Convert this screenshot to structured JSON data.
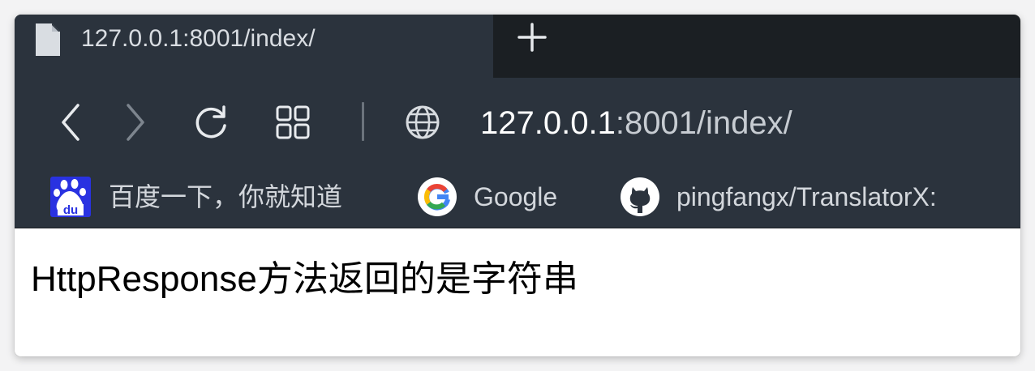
{
  "tab": {
    "title": "127.0.0.1:8001/index/",
    "icon": "document-icon"
  },
  "new_tab": {
    "icon": "plus-icon"
  },
  "toolbar": {
    "back_icon": "chevron-left-icon",
    "forward_icon": "chevron-right-icon",
    "reload_icon": "reload-icon",
    "grid_icon": "grid-icon",
    "site_icon": "globe-icon"
  },
  "address": {
    "host": "127.0.0.1",
    "path": ":8001/index/"
  },
  "bookmarks": [
    {
      "label": "百度一下，你就知道",
      "icon": "baidu-icon",
      "icon_text": "du"
    },
    {
      "label": "Google",
      "icon": "google-icon"
    },
    {
      "label": "pingfangx/TranslatorX:",
      "icon": "github-icon"
    }
  ],
  "page": {
    "text": "HttpResponse方法返回的是字符串"
  },
  "colors": {
    "tabstrip": "#1b1f23",
    "toolbar": "#2b333d",
    "baidu_blue": "#2932e1"
  }
}
